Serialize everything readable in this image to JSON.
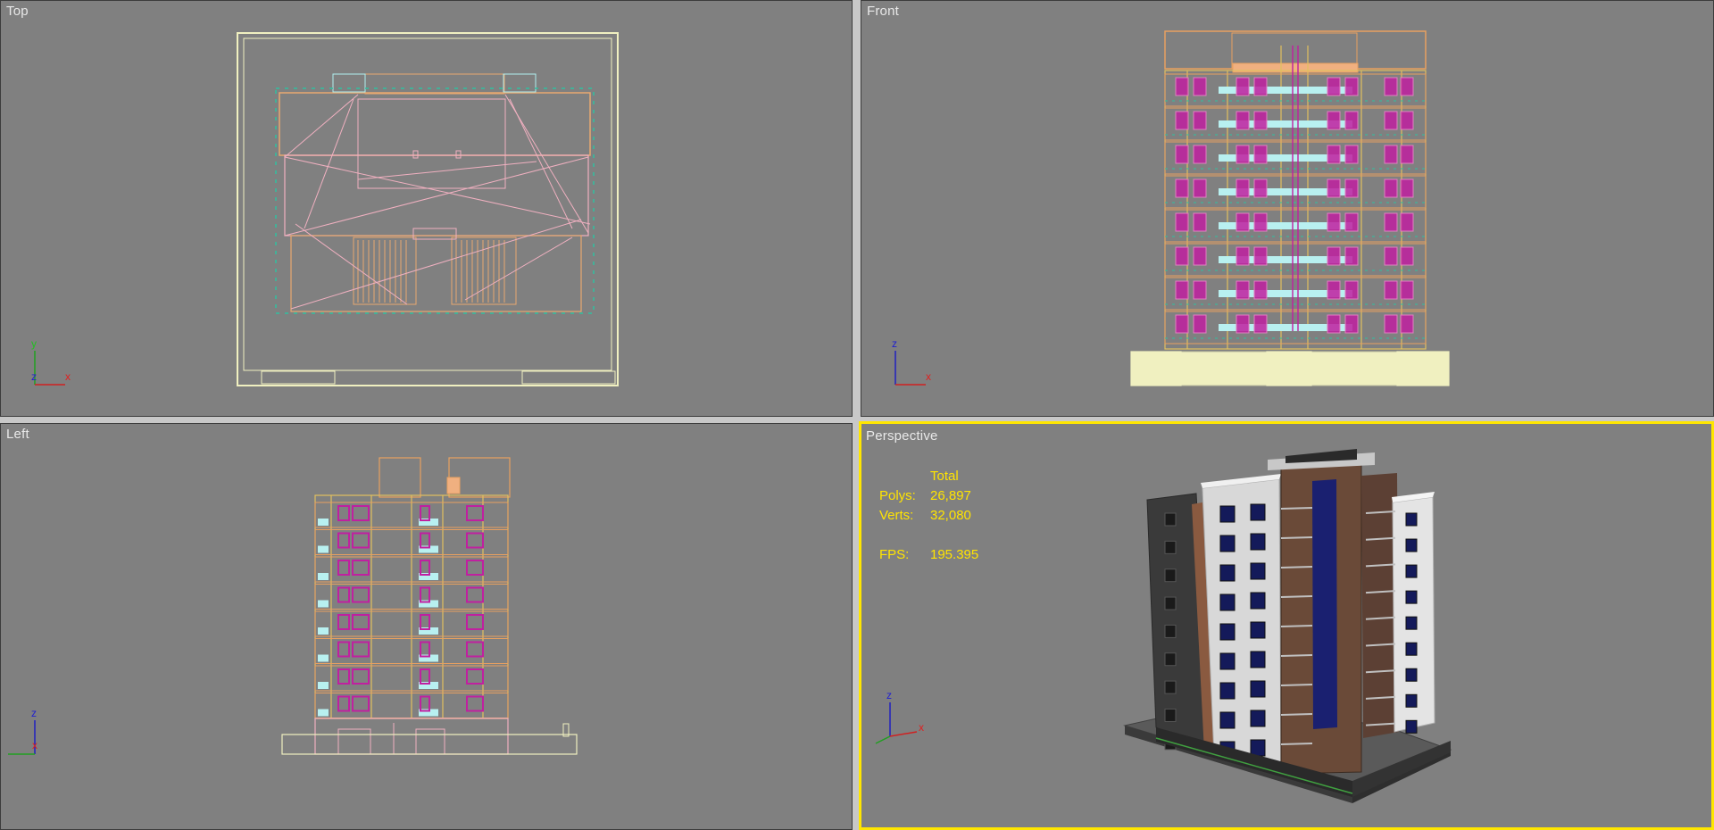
{
  "viewports": {
    "top": {
      "label": "Top"
    },
    "front": {
      "label": "Front"
    },
    "left": {
      "label": "Left"
    },
    "perspective": {
      "label": "Perspective"
    }
  },
  "stats": {
    "header": "Total",
    "polys_label": "Polys:",
    "polys_value": "26,897",
    "verts_label": "Verts:",
    "verts_value": "32,080",
    "fps_label": "FPS:",
    "fps_value": "195.395"
  },
  "axes": {
    "top": {
      "vertical": "y",
      "origin": "z",
      "horizontal": "x"
    },
    "front": {
      "vertical": "z",
      "horizontal": "x"
    },
    "left": {
      "vertical": "z",
      "horizontal": "x"
    },
    "perspective": {
      "vertical": "z",
      "horizontal": "x"
    }
  },
  "colors": {
    "viewport_bg": "#808080",
    "active_border": "#ffe600",
    "stats_text": "#ffe400",
    "wire_orange": "#e8a060",
    "wire_yellow": "#e0c060",
    "wire_magenta": "#c020a0",
    "wire_cyan": "#b0f0f0",
    "wire_pink": "#f0b0c0",
    "wire_cream": "#f0f0c0"
  }
}
